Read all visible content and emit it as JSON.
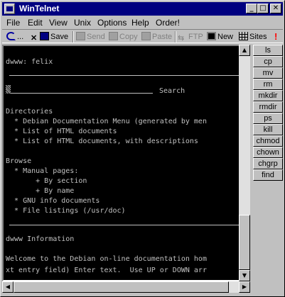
{
  "window": {
    "title": "WinTelnet"
  },
  "titlebar_buttons": {
    "minimize": "_",
    "maximize": "□",
    "close": "✕"
  },
  "menu": [
    "File",
    "Edit",
    "View",
    "Unix",
    "Options",
    "Help",
    "Order!"
  ],
  "toolbar": {
    "dots": "...",
    "save": "Save",
    "send": "Send",
    "copy": "Copy",
    "paste": "Paste",
    "ftp": "FTP",
    "new": "New",
    "sites": "Sites"
  },
  "terminal": {
    "lines": [
      "dwww: felix",
      "Search",
      "Directories",
      "  * Debian Documentation Menu (generated by men",
      "  * List of HTML documents",
      "  * List of HTML documents, with descriptions",
      "Browse",
      "  * Manual pages:",
      "       + By section",
      "       + By name",
      "  * GNU info documents",
      "  * File listings (/usr/doc)",
      "dwww Information",
      "Welcome to the Debian on-line documentation hom",
      "xt entry field) Enter text.  Use UP or DOWN arr"
    ]
  },
  "commands": [
    "ls",
    "cp",
    "mv",
    "rm",
    "mkdir",
    "rmdir",
    "ps",
    "kill",
    "chmod",
    "chown",
    "chgrp",
    "find"
  ]
}
